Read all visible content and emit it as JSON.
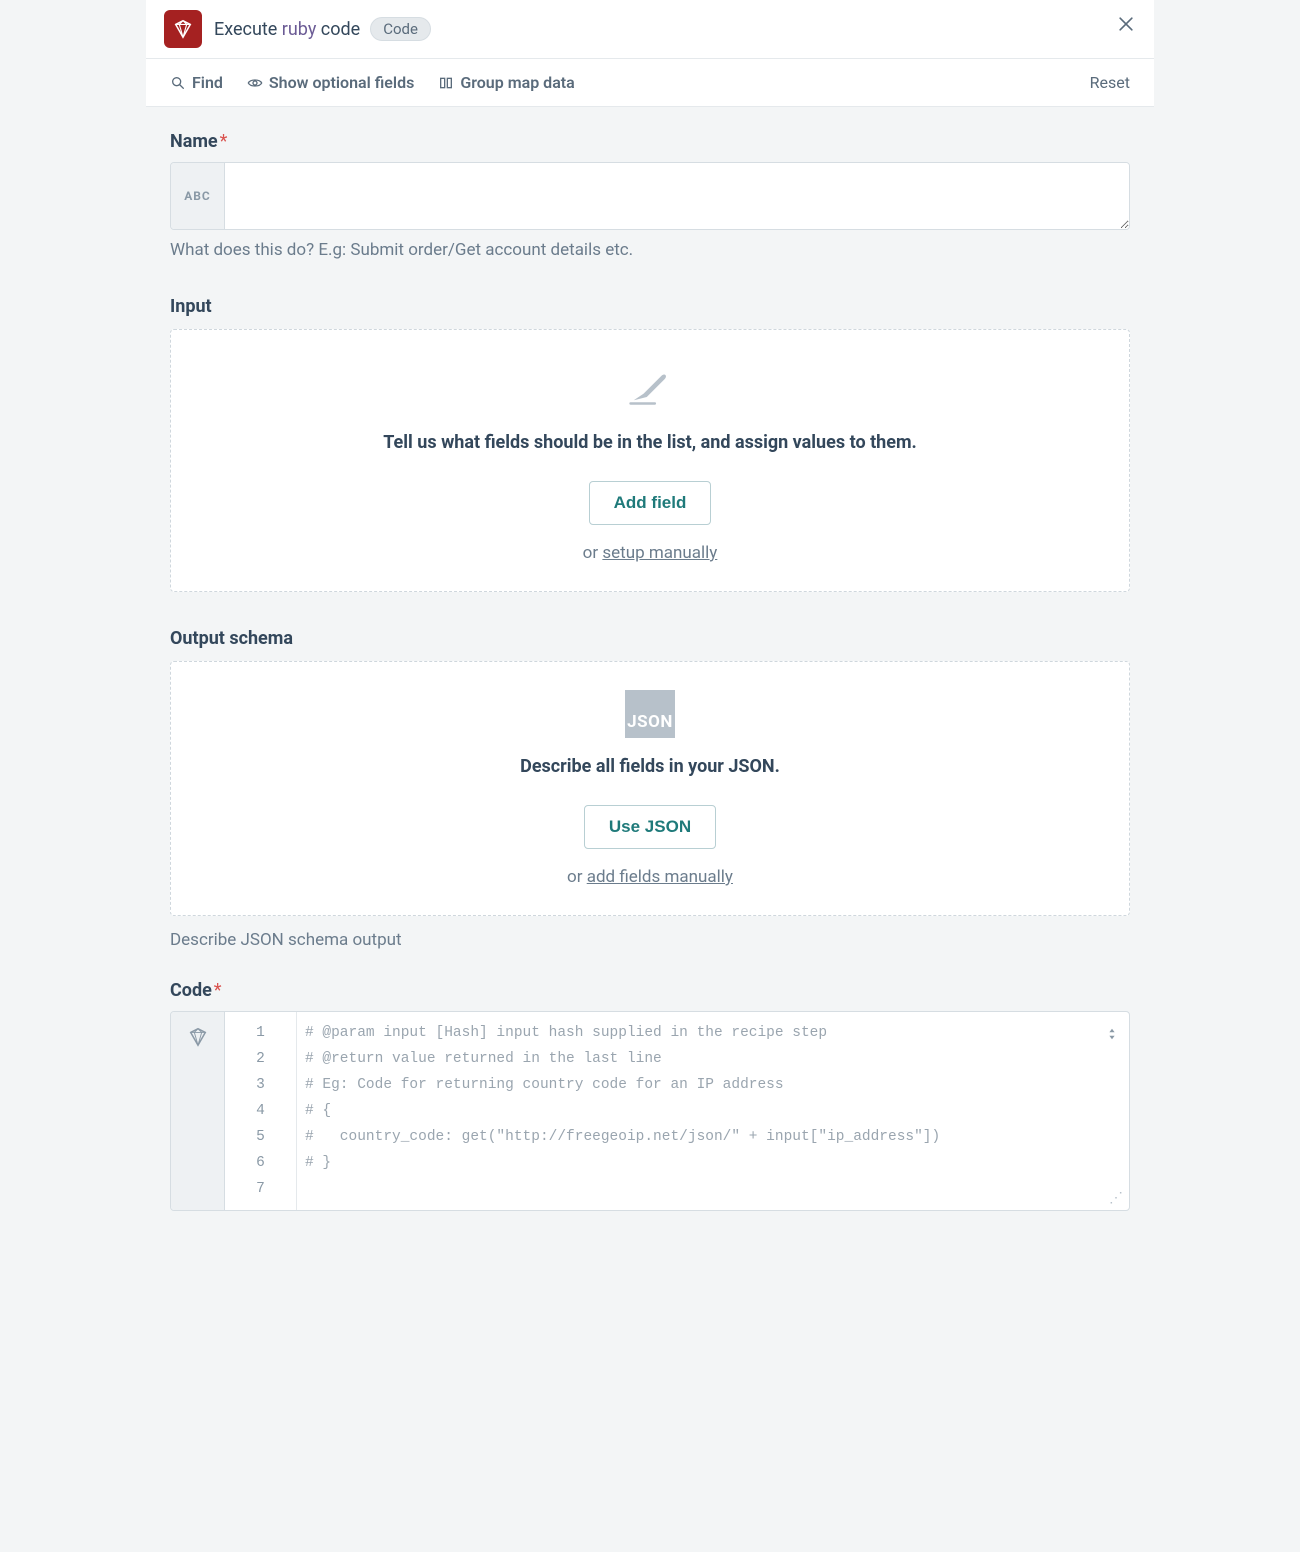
{
  "header": {
    "title_prefix": "Execute ",
    "title_link": "ruby",
    "title_suffix": " code",
    "chip": "Code"
  },
  "toolbar": {
    "find": "Find",
    "optional": "Show optional fields",
    "group": "Group map data",
    "reset": "Reset"
  },
  "name": {
    "label": "Name",
    "prefix": "ABC",
    "value": "",
    "hint": "What does this do? E.g: Submit order/Get account details etc."
  },
  "input_section": {
    "label": "Input",
    "desc": "Tell us what fields should be in the list, and assign values to them.",
    "add_btn": "Add field",
    "or": "or ",
    "manual_link": "setup manually"
  },
  "output_section": {
    "label": "Output schema",
    "icon_text": "JSON",
    "desc": "Describe all fields in your JSON.",
    "use_btn": "Use JSON",
    "or": "or ",
    "manual_link": "add fields manually",
    "hint": "Describe JSON schema output"
  },
  "code": {
    "label": "Code",
    "lines": [
      "# @param input [Hash] input hash supplied in the recipe step",
      "# @return value returned in the last line",
      "# Eg: Code for returning country code for an IP address",
      "# {",
      "#   country_code: get(\"http://freegeoip.net/json/\" + input[\"ip_address\"])",
      "# }",
      ""
    ]
  }
}
